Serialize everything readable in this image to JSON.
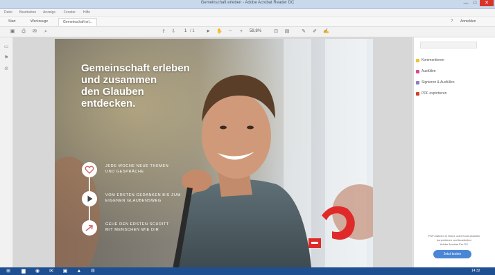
{
  "window": {
    "title": "Gemeinschaft erleben - Adobe Acrobat Reader DC",
    "controls": [
      "—",
      "□",
      "✕"
    ]
  },
  "menu": [
    "Datei",
    "Bearbeiten",
    "Anzeige",
    "Fenster",
    "Hilfe"
  ],
  "tabs": [
    {
      "label": "Start",
      "active": false
    },
    {
      "label": "Werkzeuge",
      "active": false
    },
    {
      "label": "Gemeinschaft erl...",
      "active": true
    }
  ],
  "header_right": {
    "help": "?",
    "signin": "Anmelden"
  },
  "toolbar": {
    "page_current": "1",
    "page_total": "/ 1",
    "zoom": "58,8%"
  },
  "document": {
    "headline": [
      "Gemeinschaft erleben",
      "und zusammen",
      "den Glauben",
      "entdecken."
    ],
    "features": [
      {
        "icon": "heart-icon",
        "text": [
          "Jede Woche neue Themen",
          "und Gespräche"
        ]
      },
      {
        "icon": "play-icon",
        "text": [
          "Vom ersten Gedanken bis zum",
          "eigenen Glaubensweg"
        ]
      },
      {
        "icon": "arrow-icon",
        "text": [
          "Gehe den ersten Schritt",
          "mit Menschen wie dir"
        ]
      }
    ],
    "brand_color": "#e02a2a"
  },
  "right_panel": {
    "items": [
      {
        "label": "Kommentieren",
        "color": "#f1c232"
      },
      {
        "label": "Ausfüllen",
        "color": "#d94a8c"
      },
      {
        "label": "Signieren & Ausfüllen",
        "color": "#8e7cc3"
      },
      {
        "label": "PDF exportieren",
        "color": "#cc4125"
      }
    ],
    "promo": [
      "PDF-Dateien in Word- oder Excel-Dateien",
      "konvertieren und bearbeiten",
      "Adobe Acrobat Pro DC"
    ],
    "button": "Jetzt testen"
  },
  "taskbar": {
    "clock": "14:32"
  }
}
